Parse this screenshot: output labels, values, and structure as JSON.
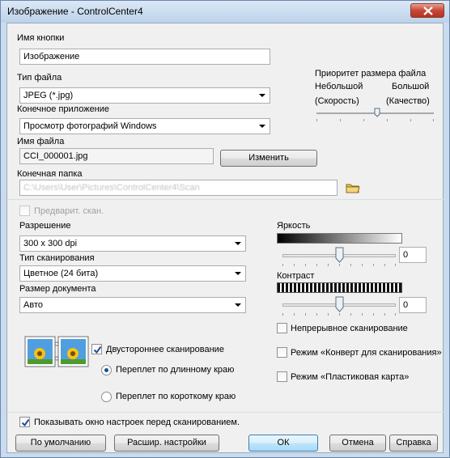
{
  "window": {
    "title": "Изображение - ControlCenter4"
  },
  "button_name": {
    "label": "Имя кнопки",
    "value": "Изображение"
  },
  "file_type": {
    "label": "Тип файла",
    "value": "JPEG (*.jpg)"
  },
  "target_app": {
    "label": "Конечное приложение",
    "value": "Просмотр фотографий Windows"
  },
  "file_name": {
    "label": "Имя файла",
    "value": "CCI_000001.jpg",
    "change_button": "Изменить"
  },
  "dest_folder": {
    "label": "Конечная папка",
    "value": "C:\\Users\\User\\Pictures\\ControlCenter4\\Scan"
  },
  "file_size_priority": {
    "title": "Приоритет размера файла",
    "small": "Небольшой",
    "small_sub": "(Скорость)",
    "large": "Большой",
    "large_sub": "(Качество)",
    "level": 0.52
  },
  "prescan": {
    "label": "Предварит. скан.",
    "checked": false,
    "enabled": false
  },
  "resolution": {
    "label": "Разрешение",
    "value": "300 x 300  dpi"
  },
  "scan_type": {
    "label": "Тип сканирования",
    "value": "Цветное (24 бита)"
  },
  "doc_size": {
    "label": "Размер документа",
    "value": "Авто"
  },
  "brightness": {
    "label": "Яркость",
    "value": "0"
  },
  "contrast": {
    "label": "Контраст",
    "value": "0"
  },
  "duplex": {
    "label": "Двустороннее сканирование",
    "checked": true,
    "long_edge": "Переплет по длинному краю",
    "short_edge": "Переплет по короткому краю",
    "selected": "long_edge"
  },
  "continuous": {
    "label": "Непрерывное сканирование",
    "checked": false
  },
  "carrier_sheet": {
    "label": "Режим «Конверт для сканирования»",
    "checked": false
  },
  "plastic_card": {
    "label": "Режим «Пластиковая карта»",
    "checked": false
  },
  "show_settings": {
    "label": "Показывать окно настроек перед сканированием.",
    "checked": true
  },
  "buttons": {
    "default": "По умолчанию",
    "advanced": "Расшир. настройки",
    "ok": "ОК",
    "cancel": "Отмена",
    "help": "Справка"
  },
  "colors": {
    "title_bar": "#c9dbef",
    "close_button": "#c6473a",
    "default_button": "#a7d9f5"
  }
}
